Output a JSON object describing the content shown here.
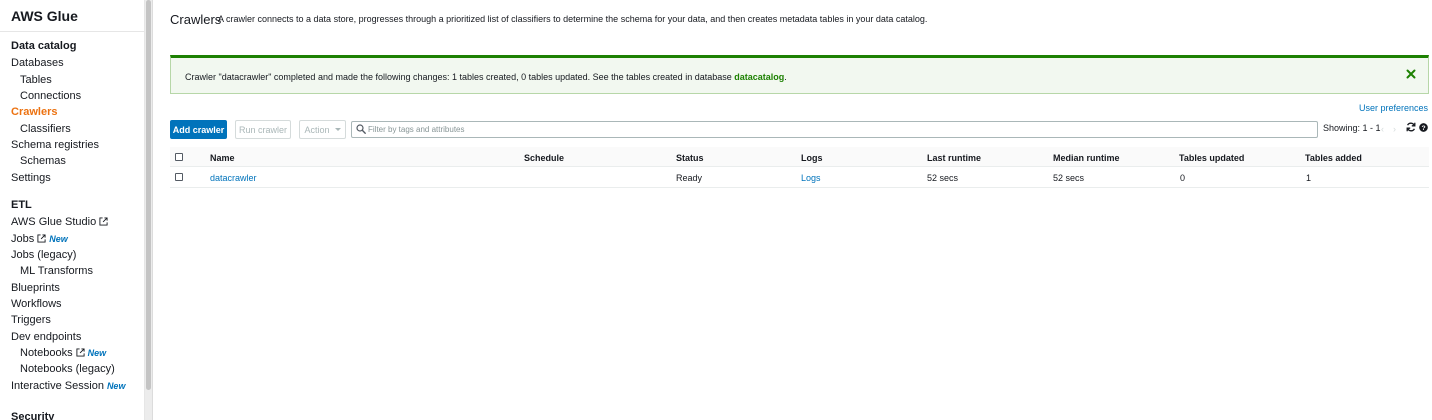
{
  "sidebar": {
    "brand": "AWS Glue",
    "sections": {
      "data_catalog": "Data catalog",
      "etl": "ETL",
      "security": "Security"
    },
    "items": {
      "databases": "Databases",
      "tables": "Tables",
      "connections": "Connections",
      "crawlers": "Crawlers",
      "classifiers": "Classifiers",
      "schema_registries": "Schema registries",
      "schemas": "Schemas",
      "settings": "Settings",
      "glue_studio": "AWS Glue Studio",
      "jobs": "Jobs",
      "jobs_legacy": "Jobs (legacy)",
      "ml_transforms": "ML Transforms",
      "blueprints": "Blueprints",
      "workflows": "Workflows",
      "triggers": "Triggers",
      "dev_endpoints": "Dev endpoints",
      "notebooks": "Notebooks",
      "notebooks_legacy": "Notebooks (legacy)",
      "interactive_session": "Interactive Session"
    },
    "new_badge": "New",
    "active_item": "crawlers",
    "accent_color": "#ec7211"
  },
  "page": {
    "title": "Crawlers",
    "description": "A crawler connects to a data store, progresses through a prioritized list of classifiers to determine the schema for your data, and then creates metadata tables in your data catalog."
  },
  "flash": {
    "message_prefix": "Crawler \"datacrawler\" completed and made the following changes: 1 tables created, 0 tables updated. See the tables created in database ",
    "database_link": "datacatalog",
    "message_suffix": ".",
    "status_color": "#1d8102"
  },
  "toolbar": {
    "user_preferences": "User preferences",
    "add_crawler": "Add crawler",
    "run_crawler": "Run crawler",
    "action": "Action",
    "search_placeholder": "Filter by tags and attributes",
    "search_value": "",
    "showing": "Showing: 1 - 1"
  },
  "table": {
    "columns": {
      "name": "Name",
      "schedule": "Schedule",
      "status": "Status",
      "logs": "Logs",
      "last_runtime": "Last runtime",
      "median_runtime": "Median runtime",
      "tables_updated": "Tables updated",
      "tables_added": "Tables added"
    },
    "rows": [
      {
        "name": "datacrawler",
        "schedule": "",
        "status": "Ready",
        "logs": "Logs",
        "last_runtime": "52 secs",
        "median_runtime": "52 secs",
        "tables_updated": "0",
        "tables_added": "1"
      }
    ]
  },
  "colors": {
    "link": "#0073bb",
    "primary_button": "#0073bb"
  }
}
